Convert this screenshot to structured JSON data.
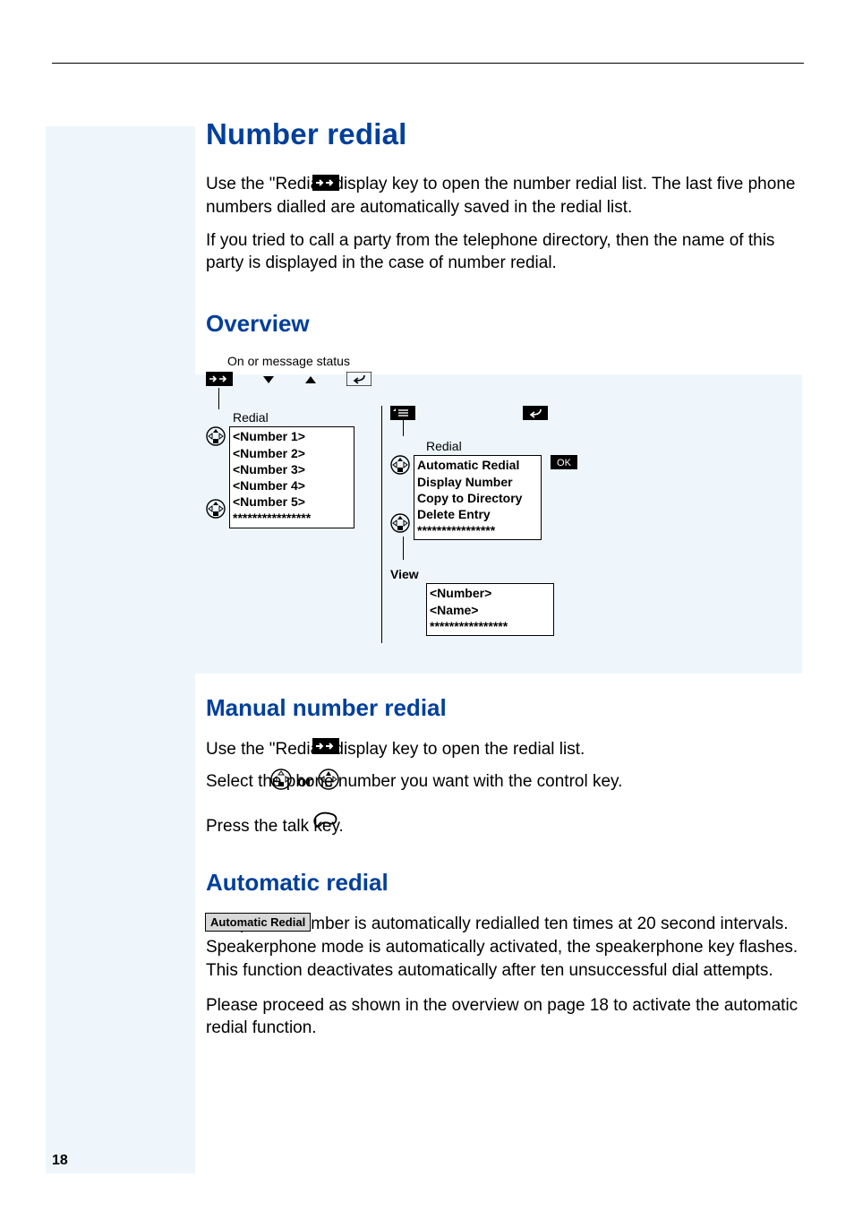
{
  "page_number": "18",
  "title": "Number redial",
  "intro_p1": "Use the \"Redial\" display key to open the number redial list. The last five phone numbers dialled are automatically saved in the redial list.",
  "intro_p2": "If you tried to call a party from the telephone directory, then the name of this party is displayed in the case of number redial.",
  "sec_overview": "Overview",
  "sec_manual": "Manual number redial",
  "sec_auto": "Automatic redial",
  "diagram": {
    "note": "On or message status",
    "col1_header": "Redial",
    "col1_items": [
      "<Number 1>",
      "<Number 2>",
      "<Number 3>",
      "<Number 4>",
      "<Number 5>",
      "****************"
    ],
    "col2_header": "Redial",
    "col2_items": [
      "Automatic Redial",
      "Display Number",
      "Copy to Directory",
      "Delete Entry",
      "****************"
    ],
    "view_label": "View",
    "view_items": [
      "<Number>",
      "<Name>",
      "****************"
    ],
    "ok_label": "OK"
  },
  "manual": {
    "step1": "Use the \"Redial\" display key to open the redial list.",
    "step2": "Select the phone number you want with the control key.",
    "step3": "Press the talk key.",
    "or": "or"
  },
  "auto": {
    "badge": "Automatic Redial",
    "p1": "The phone number is automatically redialled ten times at 20 second intervals. Speakerphone mode is automatically activated, the speakerphone key flashes. This function deactivates automatically after ten unsuccessful dial attempts.",
    "p2": "Please proceed as shown in the overview on page 18 to activate the automatic redial function."
  }
}
